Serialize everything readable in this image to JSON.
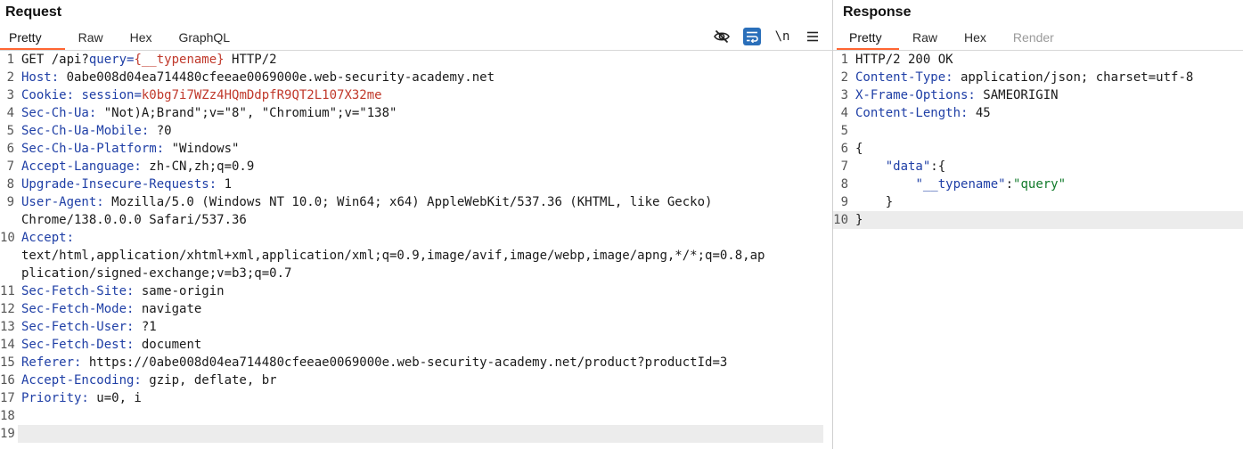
{
  "request": {
    "title": "Request",
    "tabs": [
      {
        "label": "Pretty",
        "selected": true
      },
      {
        "label": "Raw"
      },
      {
        "label": "Hex"
      },
      {
        "label": "GraphQL"
      }
    ],
    "tools": {
      "hide_icon": "eye-slash-icon",
      "wrap_icon": "word-wrap-icon",
      "newline_label": "\\n",
      "menu_icon": "hamburger-menu-icon"
    },
    "lines": {
      "l1": {
        "method": "GET /api?",
        "qkey": "query=",
        "qval": "{__typename}",
        "rest": " HTTP/2"
      },
      "l2": {
        "key": "Host:",
        "val": " 0abe008d04ea714480cfeeae0069000e.web-security-academy.net"
      },
      "l3": {
        "key": "Cookie:",
        "ckey": " session=",
        "cval": "k0bg7i7WZz4HQmDdpfR9QT2L107X32me"
      },
      "l4": {
        "key": "Sec-Ch-Ua:",
        "val": " \"Not)A;Brand\";v=\"8\", \"Chromium\";v=\"138\""
      },
      "l5": {
        "key": "Sec-Ch-Ua-Mobile:",
        "val": " ?0"
      },
      "l6": {
        "key": "Sec-Ch-Ua-Platform:",
        "val": " \"Windows\""
      },
      "l7": {
        "key": "Accept-Language:",
        "val": " zh-CN,zh;q=0.9"
      },
      "l8": {
        "key": "Upgrade-Insecure-Requests:",
        "val": " 1"
      },
      "l9": {
        "key": "User-Agent:",
        "val": " Mozilla/5.0 (Windows NT 10.0; Win64; x64) AppleWebKit/537.36 (KHTML, like Gecko)",
        "val2": "Chrome/138.0.0.0 Safari/537.36"
      },
      "l10": {
        "key": "Accept:",
        "val": "text/html,application/xhtml+xml,application/xml;q=0.9,image/avif,image/webp,image/apng,*/*;q=0.8,ap",
        "val2": "plication/signed-exchange;v=b3;q=0.7"
      },
      "l11": {
        "key": "Sec-Fetch-Site:",
        "val": " same-origin"
      },
      "l12": {
        "key": "Sec-Fetch-Mode:",
        "val": " navigate"
      },
      "l13": {
        "key": "Sec-Fetch-User:",
        "val": " ?1"
      },
      "l14": {
        "key": "Sec-Fetch-Dest:",
        "val": " document"
      },
      "l15": {
        "key": "Referer:",
        "val": " https://0abe008d04ea714480cfeeae0069000e.web-security-academy.net/product?productId=3"
      },
      "l16": {
        "key": "Accept-Encoding:",
        "val": " gzip, deflate, br"
      },
      "l17": {
        "key": "Priority:",
        "val": " u=0, i"
      }
    },
    "line_numbers": [
      "1",
      "2",
      "3",
      "4",
      "5",
      "6",
      "7",
      "8",
      "9",
      "10",
      "11",
      "12",
      "13",
      "14",
      "15",
      "16",
      "17",
      "18",
      "19"
    ]
  },
  "response": {
    "title": "Response",
    "tabs": [
      {
        "label": "Pretty",
        "selected": true
      },
      {
        "label": "Raw"
      },
      {
        "label": "Hex"
      },
      {
        "label": "Render",
        "disabled": true
      }
    ],
    "lines": {
      "l1": {
        "val": "HTTP/2 200 OK"
      },
      "l2": {
        "key": "Content-Type:",
        "val": " application/json; charset=utf-8"
      },
      "l3": {
        "key": "X-Frame-Options:",
        "val": " SAMEORIGIN"
      },
      "l4": {
        "key": "Content-Length:",
        "val": " 45"
      },
      "l6": {
        "val": "{"
      },
      "l7": {
        "indent": "    ",
        "key": "\"data\"",
        "rest": ":{"
      },
      "l8": {
        "indent": "        ",
        "key": "\"__typename\"",
        "colon": ":",
        "str": "\"query\""
      },
      "l9": {
        "val": "    }"
      },
      "l10": {
        "val": "}"
      }
    },
    "line_numbers": [
      "1",
      "2",
      "3",
      "4",
      "5",
      "6",
      "7",
      "8",
      "9",
      "10"
    ]
  }
}
